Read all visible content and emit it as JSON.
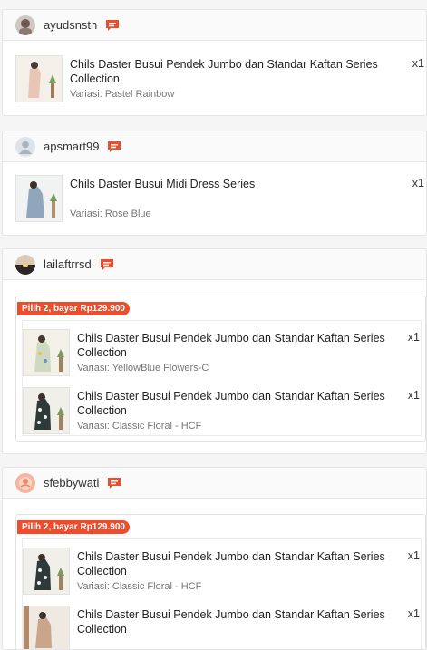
{
  "orders": [
    {
      "user": "ayudsnstn",
      "items": [
        {
          "title": "Chils Daster Busui Pendek Jumbo dan Standar Kaftan Series Collection",
          "variant": "Variasi: Pastel Rainbow",
          "qty": "x1"
        }
      ]
    },
    {
      "user": "apsmart99",
      "items": [
        {
          "title": "Chils Daster Busui Midi Dress Series",
          "variant": "Variasi: Rose Blue",
          "qty": "x1"
        }
      ]
    },
    {
      "user": "lailaftrrsd",
      "bundle_label": "Pilih 2, bayar Rp129.900",
      "items": [
        {
          "title": "Chils Daster Busui Pendek Jumbo dan Standar Kaftan Series Collection",
          "variant": "Variasi: YellowBlue Flowers-C",
          "qty": "x1"
        },
        {
          "title": "Chils Daster Busui Pendek Jumbo dan Standar Kaftan Series Collection",
          "variant": "Variasi: Classic Floral - HCF",
          "qty": "x1"
        }
      ]
    },
    {
      "user": "sfebbywati",
      "bundle_label": "Pilih 2, bayar Rp129.900",
      "items": [
        {
          "title": "Chils Daster Busui Pendek Jumbo dan Standar Kaftan Series Collection",
          "variant": "Variasi: Classic Floral - HCF",
          "qty": "x1"
        },
        {
          "title": "Chils Daster Busui Pendek Jumbo dan Standar Kaftan Series Collection",
          "variant": "",
          "qty": "x1"
        }
      ]
    }
  ],
  "colors": {
    "accent": "#ee4d2d"
  }
}
